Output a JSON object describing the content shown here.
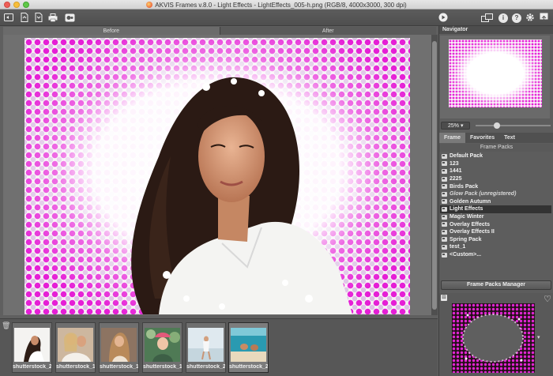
{
  "window": {
    "title": "AKVIS Frames v.8.0 - Light Effects - LightEffects_005-h.png (RGB/8, 4000x3000, 300 dpi)"
  },
  "toolbar": {
    "left_icons": [
      "workspace-icon",
      "open-icon",
      "save-icon",
      "print-icon",
      "batch-icon"
    ],
    "right_icons": [
      "run-icon",
      "preferences-icon",
      "info-icon",
      "help-icon",
      "settings-icon",
      "export-icon"
    ]
  },
  "compare": {
    "before": "Before",
    "after": "After"
  },
  "navigator": {
    "title": "Navigator",
    "zoom": "25%"
  },
  "panel_tabs": [
    "Frame",
    "Favorites",
    "Text"
  ],
  "frame_packs": {
    "title": "Frame Packs",
    "items": [
      "Default Pack",
      "123",
      "1441",
      "2225",
      "Birds Pack",
      "Glow Pack (unregistered)",
      "Golden Autumn",
      "Light Effects",
      "Magic Winter",
      "Overlay Effects",
      "Overlay Effects II",
      "Spring Pack",
      "test_1",
      "<Custom>..."
    ],
    "selected": "Light Effects",
    "manager_button": "Frame Packs Manager"
  },
  "filmstrip": {
    "items": [
      "shutterstock_2...",
      "shutterstock_1...",
      "shutterstock_1...",
      "shutterstock_1...",
      "shutterstock_2...",
      "shutterstock_2..."
    ]
  },
  "colors": {
    "accent": "#e022d4",
    "panel": "#5d5d5d",
    "selection": "#333333"
  }
}
